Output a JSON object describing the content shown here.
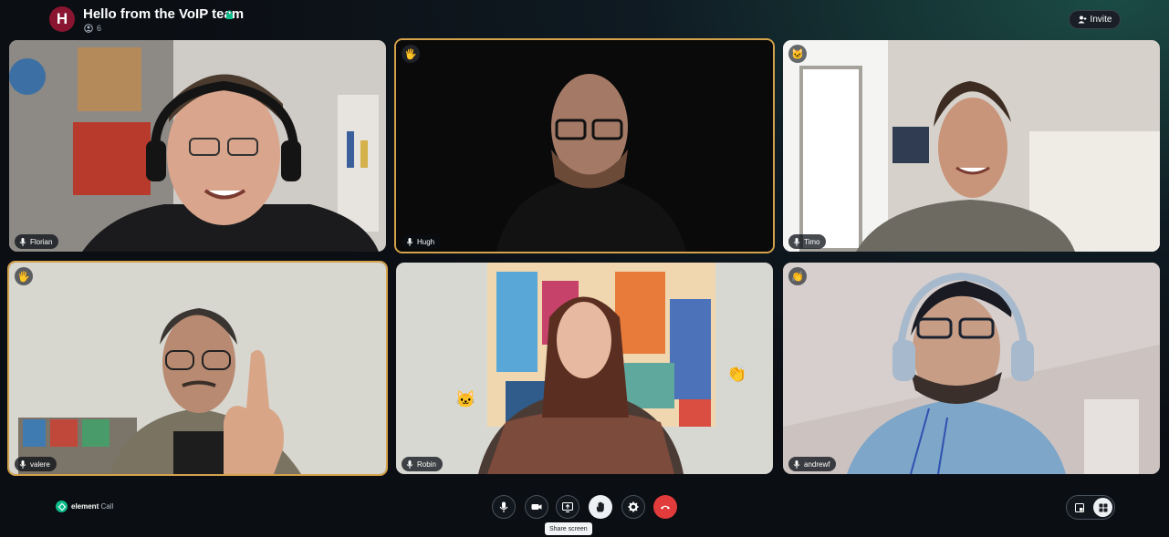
{
  "room": {
    "avatar_letter": "H",
    "title": "Hello from the VoIP team",
    "participant_count": "6",
    "invite_label": "Invite"
  },
  "tiles": [
    {
      "name": "Florian",
      "reaction": "",
      "hand_raised": false
    },
    {
      "name": "Hugh",
      "reaction": "🖐",
      "hand_raised": true
    },
    {
      "name": "Timo",
      "reaction": "🐱",
      "hand_raised": false
    },
    {
      "name": "valere",
      "reaction": "🖐",
      "hand_raised": true
    },
    {
      "name": "Robin",
      "reaction": "",
      "hand_raised": false
    },
    {
      "name": "andrewf",
      "reaction": "👏",
      "hand_raised": false
    }
  ],
  "floating_reactions": [
    "🐱",
    "👏"
  ],
  "brand": {
    "name_bold": "element",
    "name_light": "Call"
  },
  "controls": {
    "mic": "microphone-icon",
    "camera": "video-camera-icon",
    "share": "share-screen-icon",
    "raise_hand": "raise-hand-icon",
    "settings": "gear-icon",
    "end_call": "hang-up-icon"
  },
  "tooltip": "Share screen",
  "colors": {
    "hand_raised_border": "#d4a24a",
    "end_call": "#e13b3b",
    "avatar": "#8a1530",
    "brand": "#0dbd8b"
  }
}
